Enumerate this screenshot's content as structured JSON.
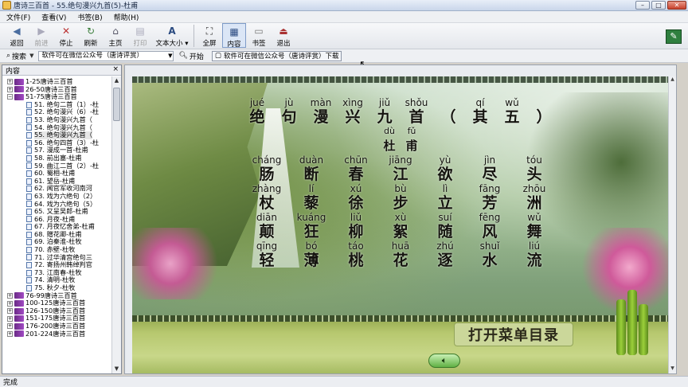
{
  "window": {
    "title": "唐诗三百首 - 55.绝句漫兴九首(5)-杜甫"
  },
  "menu": [
    "文件(F)",
    "查看(V)",
    "书签(B)",
    "帮助(H)"
  ],
  "toolbar": {
    "buttons": [
      {
        "label": "返回",
        "icon": "back-arrow-icon",
        "enabled": true
      },
      {
        "label": "前进",
        "icon": "forward-arrow-icon",
        "enabled": false
      },
      {
        "label": "停止",
        "icon": "stop-icon",
        "enabled": true
      },
      {
        "label": "刷新",
        "icon": "refresh-icon",
        "enabled": true
      },
      {
        "label": "主页",
        "icon": "home-icon",
        "enabled": true
      },
      {
        "label": "打印",
        "icon": "printer-icon",
        "enabled": false
      },
      {
        "label": "文本大小",
        "icon": "text-size-icon",
        "enabled": true
      },
      {
        "label": "全屏",
        "icon": "fullscreen-icon",
        "enabled": true
      },
      {
        "label": "内容",
        "icon": "contents-icon",
        "enabled": true,
        "active": true
      },
      {
        "label": "书签",
        "icon": "bookmark-icon",
        "enabled": true
      },
      {
        "label": "退出",
        "icon": "exit-icon",
        "enabled": true
      }
    ]
  },
  "addressbar": {
    "search_label": "搜索",
    "search_value": "软件可在微信公众号（唐诗评赏）",
    "start_label": "开始",
    "download_label": "软件可在微信公众号（唐诗评赏）下载"
  },
  "sidebar": {
    "title": "内容",
    "close": "×",
    "tree": [
      {
        "label": "1-25唐诗三百首",
        "level": 0,
        "expanded": false
      },
      {
        "label": "26-50唐诗三百首",
        "level": 0,
        "expanded": false
      },
      {
        "label": "51-75唐诗三百首",
        "level": 0,
        "expanded": true
      },
      {
        "label": "51. 绝句二首（1）-杜",
        "level": 1
      },
      {
        "label": "52. 绝句漫兴（6）-杜",
        "level": 1
      },
      {
        "label": "53. 绝句漫兴九首（",
        "level": 1
      },
      {
        "label": "54. 绝句漫兴九首（",
        "level": 1
      },
      {
        "label": "55. 绝句漫兴九首（",
        "level": 1,
        "selected": true
      },
      {
        "label": "56. 绝句四首（3）-杜",
        "level": 1
      },
      {
        "label": "57. 漫成一首-杜甫",
        "level": 1
      },
      {
        "label": "58. 前出塞-杜甫",
        "level": 1
      },
      {
        "label": "59. 曲江二首（2）-杜",
        "level": 1
      },
      {
        "label": "60. 蜀相-杜甫",
        "level": 1
      },
      {
        "label": "61. 望岳-杜甫",
        "level": 1
      },
      {
        "label": "62. 闻官军收河南河",
        "level": 1
      },
      {
        "label": "63. 戏为六绝句（2）",
        "level": 1
      },
      {
        "label": "64. 戏为六绝句（5）",
        "level": 1
      },
      {
        "label": "65. 又呈吴郎-杜甫",
        "level": 1
      },
      {
        "label": "66. 月夜-杜甫",
        "level": 1
      },
      {
        "label": "67. 月夜忆舍弟-杜甫",
        "level": 1
      },
      {
        "label": "68. 赠花卿-杜甫",
        "level": 1
      },
      {
        "label": "69. 泊秦淮-杜牧",
        "level": 1
      },
      {
        "label": "70. 赤壁-杜牧",
        "level": 1
      },
      {
        "label": "71. 过华清宫绝句三",
        "level": 1
      },
      {
        "label": "72. 寄扬州韩绰判官",
        "level": 1
      },
      {
        "label": "73. 江南春-杜牧",
        "level": 1
      },
      {
        "label": "74. 清明-杜牧",
        "level": 1
      },
      {
        "label": "75. 秋夕-杜牧",
        "level": 1
      },
      {
        "label": "76-99唐诗三百首",
        "level": 0,
        "expanded": false
      },
      {
        "label": "100-125唐诗三百首",
        "level": 0,
        "expanded": false
      },
      {
        "label": "126-150唐诗三百首",
        "level": 0,
        "expanded": false
      },
      {
        "label": "151-175唐诗三百首",
        "level": 0,
        "expanded": false
      },
      {
        "label": "176-200唐诗三百首",
        "level": 0,
        "expanded": false
      },
      {
        "label": "201-224唐诗三百首",
        "level": 0,
        "expanded": false
      }
    ]
  },
  "poem": {
    "title": {
      "pinyin": [
        "jué",
        "jù",
        "màn",
        "xìng",
        "jiǔ",
        "shǒu",
        "",
        "qí",
        "wǔ",
        ""
      ],
      "hanzi": [
        "绝",
        "句",
        "漫",
        "兴",
        "九",
        "首",
        "（",
        "其",
        "五",
        "）"
      ]
    },
    "author": {
      "pinyin": [
        "dù",
        "fǔ"
      ],
      "hanzi": [
        "杜",
        "甫"
      ]
    },
    "lines": [
      {
        "pinyin": [
          "cháng",
          "duàn",
          "chūn",
          "jiāng",
          "yù",
          "jìn",
          "tóu"
        ],
        "hanzi": [
          "肠",
          "断",
          "春",
          "江",
          "欲",
          "尽",
          "头"
        ]
      },
      {
        "pinyin": [
          "zhàng",
          "lí",
          "xú",
          "bù",
          "lì",
          "fāng",
          "zhōu"
        ],
        "hanzi": [
          "杖",
          "藜",
          "徐",
          "步",
          "立",
          "芳",
          "洲"
        ]
      },
      {
        "pinyin": [
          "diān",
          "kuáng",
          "liǔ",
          "xù",
          "suí",
          "fēng",
          "wǔ"
        ],
        "hanzi": [
          "颠",
          "狂",
          "柳",
          "絮",
          "随",
          "风",
          "舞"
        ]
      },
      {
        "pinyin": [
          "qīng",
          "bó",
          "táo",
          "huā",
          "zhú",
          "shuǐ",
          "liú"
        ],
        "hanzi": [
          "轻",
          "薄",
          "桃",
          "花",
          "逐",
          "水",
          "流"
        ]
      }
    ]
  },
  "open_menu_label": "打开菜单目录",
  "status": "完成",
  "colors": {
    "accent": "#7f9cc8",
    "frame_green": "#8ea44a",
    "blossom": "#cf5a9a"
  }
}
